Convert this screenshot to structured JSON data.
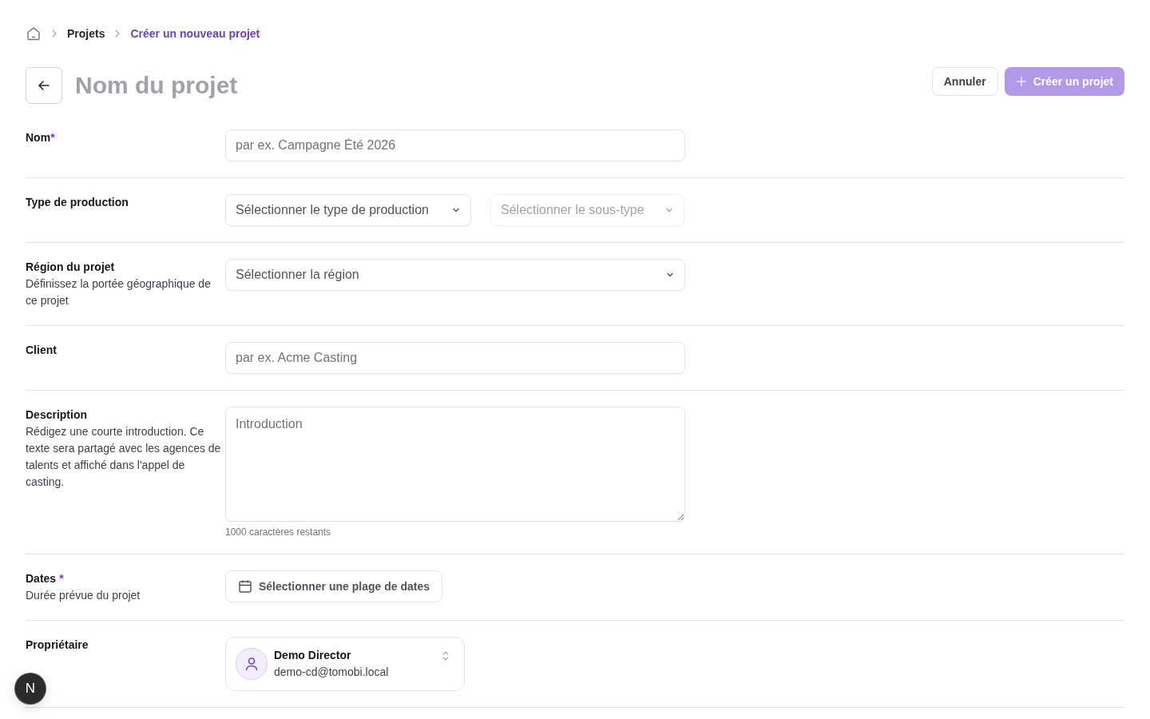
{
  "breadcrumb": [
    {
      "label": "Projets",
      "current": false
    },
    {
      "label": "Créer un nouveau projet",
      "current": true
    }
  ],
  "header": {
    "title": "Nom du projet",
    "cancel": "Annuler",
    "create": "Créer un projet",
    "create_disabled": true
  },
  "rows": [
    {
      "label": "Nom",
      "required_mark": "*",
      "fields": [
        {
          "kind": "text",
          "placeholder": "par ex. Campagne Été 2026"
        }
      ]
    },
    {
      "label": "Type de production",
      "fields": [
        {
          "kind": "select",
          "placeholder": "Sélectionner le type de production",
          "disabled": false
        },
        {
          "kind": "select",
          "placeholder": "Sélectionner le sous-type",
          "disabled": true
        }
      ]
    },
    {
      "label": "Région du projet",
      "hint": "Définissez la portée géographique de ce projet",
      "fields": [
        {
          "kind": "select",
          "placeholder": "Sélectionner la région",
          "disabled": false
        }
      ]
    },
    {
      "label": "Client",
      "fields": [
        {
          "kind": "text",
          "placeholder": "par ex. Acme Casting"
        }
      ]
    },
    {
      "label": "Description",
      "hint": "Rédigez une courte introduction. Ce texte sera partagé avec les agences de talents et affiché dans l'appel de casting.",
      "fields": [
        {
          "kind": "textarea",
          "placeholder": "Introduction",
          "counter": "1000 caractères restants"
        }
      ]
    },
    {
      "label": "Dates",
      "required_mark": "*",
      "hint": "Durée prévue du projet",
      "fields": [
        {
          "kind": "daterange",
          "label": "Sélectionner une plage de dates"
        }
      ]
    },
    {
      "label": "Propriétaire",
      "fields": [
        {
          "kind": "owner",
          "name": "Demo Director",
          "email": "demo-cd@tomobi.local"
        }
      ]
    }
  ],
  "dev_badge": {
    "letter": "N"
  }
}
